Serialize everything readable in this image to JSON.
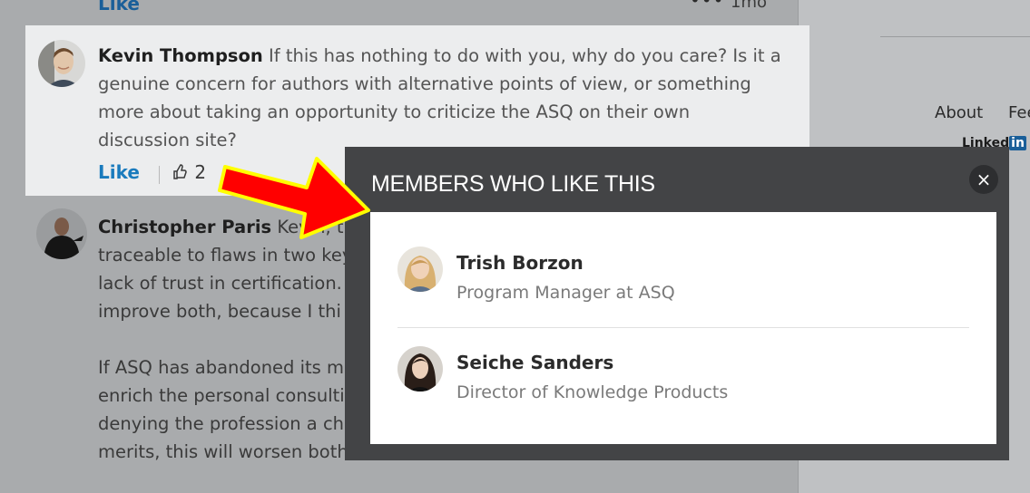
{
  "top": {
    "like_label": "Like",
    "time": "1mo",
    "more": "•••"
  },
  "comments": [
    {
      "author": "Kevin Thompson",
      "lines": [
        "If this has nothing to do with you, why do you care? Is it a",
        "genuine concern for authors with alternative points of view, or something",
        "more about taking an opportunity to criticize the ASQ on their own",
        "discussion site?"
      ],
      "like_label": "Like",
      "like_count": "2"
    },
    {
      "author": "Christopher Paris",
      "lines": [
        "Kevin, the",
        "traceable to flaws in two key",
        "lack of trust in certification.",
        "improve both, because I thi",
        "",
        "If ASQ has abandoned its mi",
        "enrich the personal consulti",
        "denying the profession a cha",
        "merits, this will worsen both"
      ]
    }
  ],
  "right_rail": {
    "footer_links": [
      "About",
      "Fee"
    ],
    "logo_text": "Linked",
    "logo_in": "in"
  },
  "modal": {
    "title": "MEMBERS WHO LIKE THIS",
    "close_label": "×",
    "members": [
      {
        "name": "Trish Borzon",
        "title": "Program Manager at ASQ"
      },
      {
        "name": "Seiche Sanders",
        "title": "Director of Knowledge Products"
      }
    ]
  },
  "colors": {
    "accent": "#1a7bbd",
    "annotation_arrow": "#ff0000",
    "annotation_outline": "#ffff00"
  }
}
